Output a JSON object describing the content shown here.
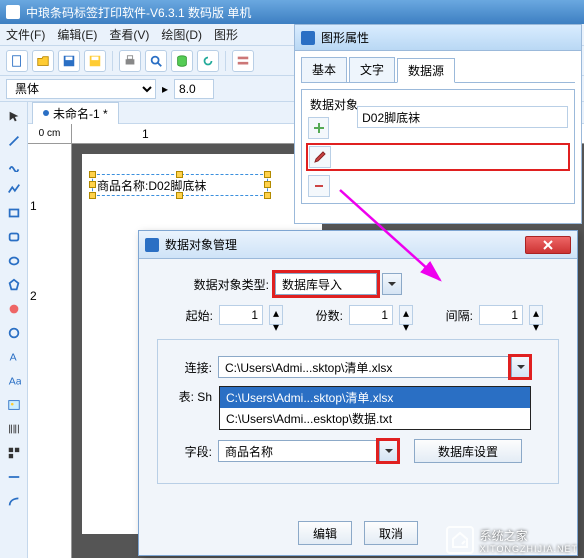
{
  "app": {
    "title": "中琅条码标签打印软件-V6.3.1 数码版 单机"
  },
  "menu": {
    "file": "文件(F)",
    "edit": "编辑(E)",
    "view": "查看(V)",
    "draw": "绘图(D)",
    "shape": "图形"
  },
  "font": {
    "name": "黑体",
    "size": "8.0"
  },
  "document": {
    "tab_title": "未命名-1 *",
    "ruler_unit": "0 cm",
    "ruler_marks_h": [
      "1"
    ],
    "ruler_marks_v": [
      "1",
      "2"
    ]
  },
  "canvas": {
    "text_label": "商品名称:",
    "text_value": "D02脚底袜"
  },
  "props": {
    "title": "图形属性",
    "tabs": [
      "基本",
      "文字",
      "数据源"
    ],
    "active_tab": 2,
    "group_label": "数据对象",
    "list_value": "D02脚底袜",
    "icons": [
      "add",
      "edit",
      "delete"
    ]
  },
  "dialog": {
    "title": "数据对象管理",
    "type_label": "数据对象类型:",
    "type_value": "数据库导入",
    "start_label": "起始:",
    "start_value": "1",
    "count_label": "份数:",
    "count_value": "1",
    "gap_label": "间隔:",
    "gap_value": "1",
    "conn_label": "连接:",
    "conn_value": "C:\\Users\\Admi...sktop\\清单.xlsx",
    "table_label": "表: Sh",
    "dropdown_items": [
      "C:\\Users\\Admi...sktop\\清单.xlsx",
      "C:\\Users\\Admi...esktop\\数据.txt"
    ],
    "dropdown_selected": 0,
    "field_label": "字段:",
    "field_value": "商品名称",
    "db_settings": "数据库设置",
    "btn_edit": "编辑",
    "btn_cancel": "取消"
  },
  "watermark": {
    "name": "系统之家",
    "url": "XITONGZHIJIA.NET"
  }
}
